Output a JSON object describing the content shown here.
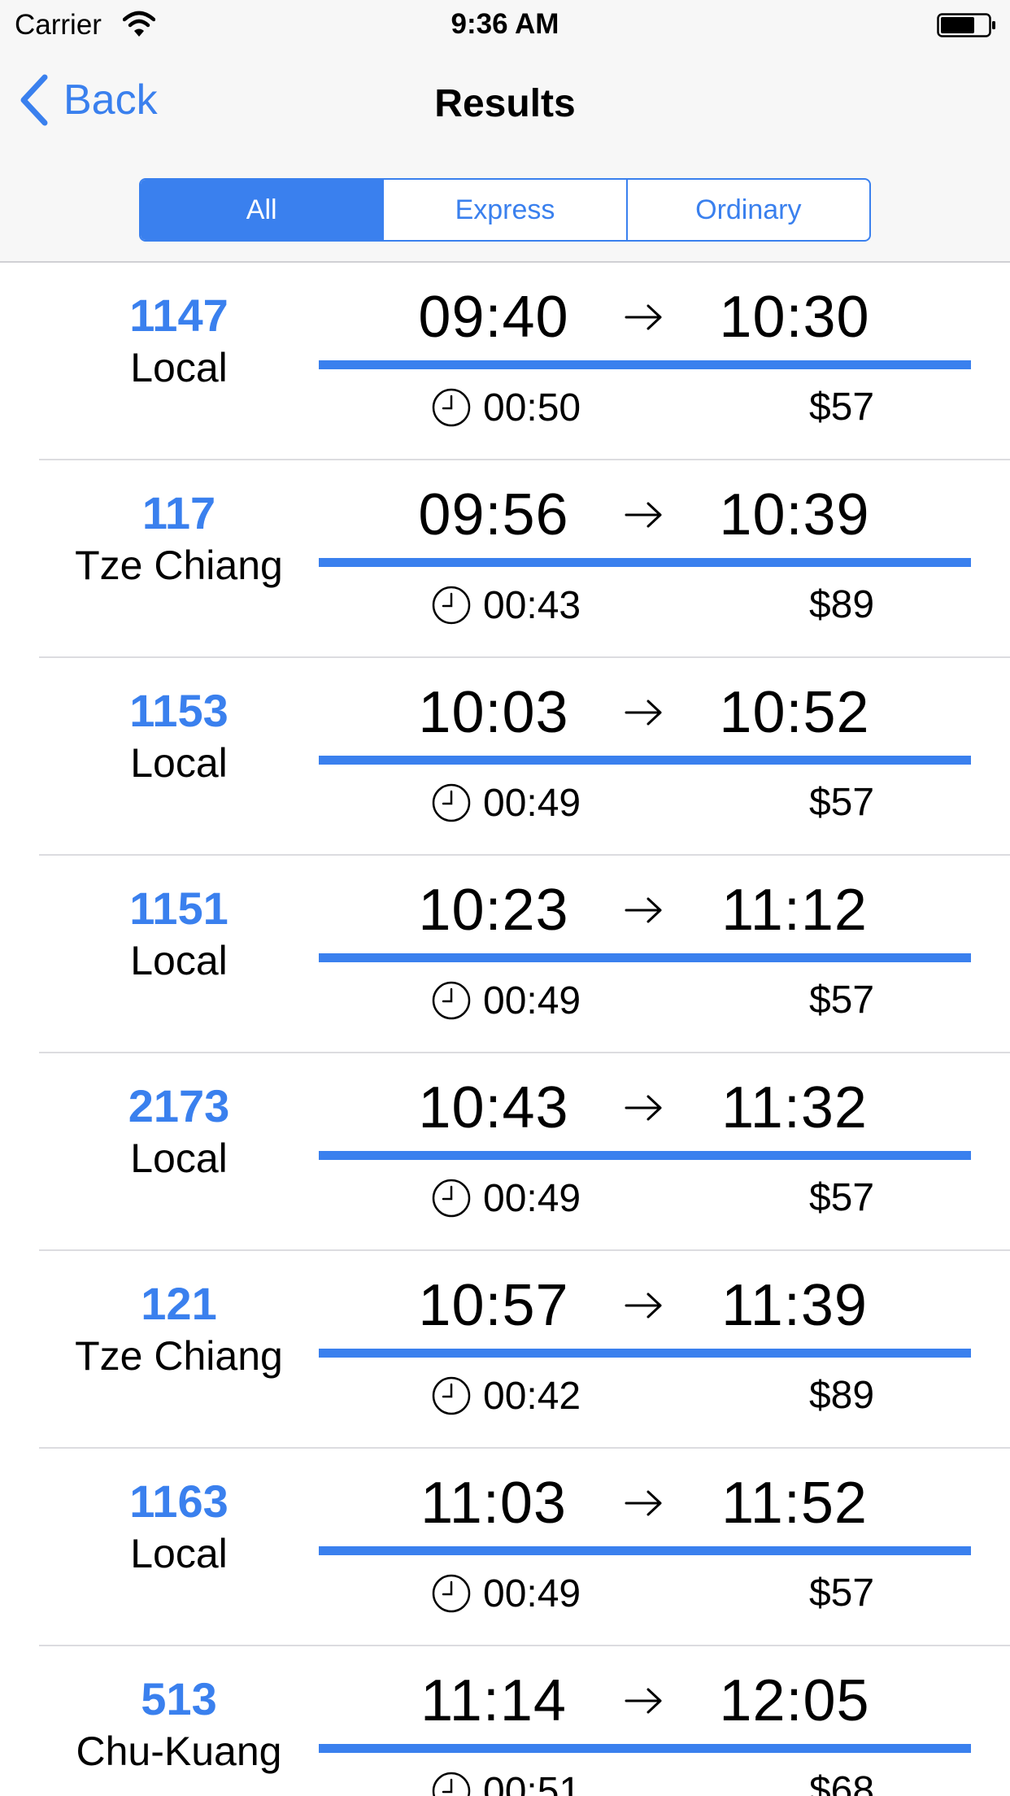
{
  "status_bar": {
    "carrier": "Carrier",
    "time": "9:36 AM"
  },
  "nav": {
    "back_label": "Back",
    "title": "Results"
  },
  "segments": [
    {
      "label": "All",
      "selected": true
    },
    {
      "label": "Express",
      "selected": false
    },
    {
      "label": "Ordinary",
      "selected": false
    }
  ],
  "colors": {
    "accent": "#3a80ee",
    "separator": "#dcdce0",
    "chrome_background": "#f7f7f7"
  },
  "icons": {
    "wifi": "wifi-icon",
    "battery": "battery-icon",
    "back": "chevron-left-icon",
    "arrow": "arrow-right-icon",
    "duration": "clock-icon"
  },
  "trains": [
    {
      "number": "1147",
      "type": "Local",
      "depart": "09:40",
      "arrive": "10:30",
      "duration": "00:50",
      "price": "$57"
    },
    {
      "number": "117",
      "type": "Tze Chiang",
      "depart": "09:56",
      "arrive": "10:39",
      "duration": "00:43",
      "price": "$89"
    },
    {
      "number": "1153",
      "type": "Local",
      "depart": "10:03",
      "arrive": "10:52",
      "duration": "00:49",
      "price": "$57"
    },
    {
      "number": "1151",
      "type": "Local",
      "depart": "10:23",
      "arrive": "11:12",
      "duration": "00:49",
      "price": "$57"
    },
    {
      "number": "2173",
      "type": "Local",
      "depart": "10:43",
      "arrive": "11:32",
      "duration": "00:49",
      "price": "$57"
    },
    {
      "number": "121",
      "type": "Tze Chiang",
      "depart": "10:57",
      "arrive": "11:39",
      "duration": "00:42",
      "price": "$89"
    },
    {
      "number": "1163",
      "type": "Local",
      "depart": "11:03",
      "arrive": "11:52",
      "duration": "00:49",
      "price": "$57"
    },
    {
      "number": "513",
      "type": "Chu-Kuang",
      "depart": "11:14",
      "arrive": "12:05",
      "duration": "00:51",
      "price": "$68"
    }
  ]
}
